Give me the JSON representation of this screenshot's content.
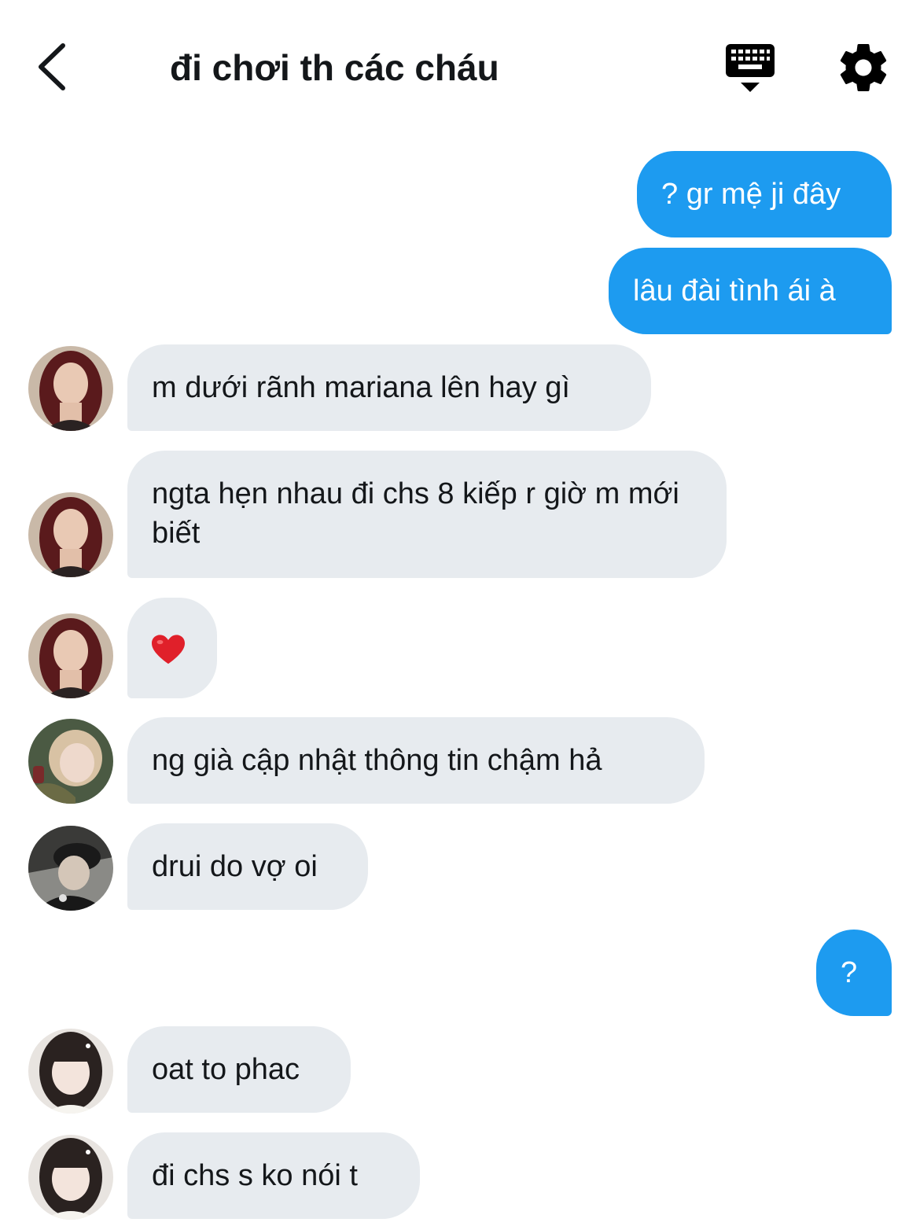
{
  "header": {
    "title": "đi chơi th các cháu"
  },
  "messages": [
    {
      "direction": "out",
      "text": "? gr mệ ji đây"
    },
    {
      "direction": "out",
      "text": "lâu đài tình ái à"
    },
    {
      "direction": "in",
      "sender_avatar": "avatar-red-hair",
      "text": "m dưới rãnh mariana lên hay gì"
    },
    {
      "direction": "in",
      "sender_avatar": "avatar-red-hair",
      "text": "ngta hẹn nhau đi chs 8 kiếp r giờ m mới biết"
    },
    {
      "direction": "in",
      "sender_avatar": "avatar-red-hair",
      "text": "",
      "emoji": "heart-emoji"
    },
    {
      "direction": "in",
      "sender_avatar": "avatar-blonde",
      "text": "ng già cập nhật thông tin chậm hả"
    },
    {
      "direction": "in",
      "sender_avatar": "avatar-cap",
      "text": "drui do vợ oi"
    },
    {
      "direction": "out",
      "text": "?"
    },
    {
      "direction": "in",
      "sender_avatar": "avatar-bangs",
      "text": "oat to phac"
    },
    {
      "direction": "in",
      "sender_avatar": "avatar-bangs",
      "text": "đi chs s ko nói t"
    }
  ],
  "colors": {
    "outgoing_bubble": "#1d9bf0",
    "incoming_bubble": "#e7ebef",
    "text_dark": "#14171a"
  },
  "icons": {
    "back": "chevron-left-icon",
    "keyboard": "keyboard-icon",
    "settings": "gear-icon"
  }
}
